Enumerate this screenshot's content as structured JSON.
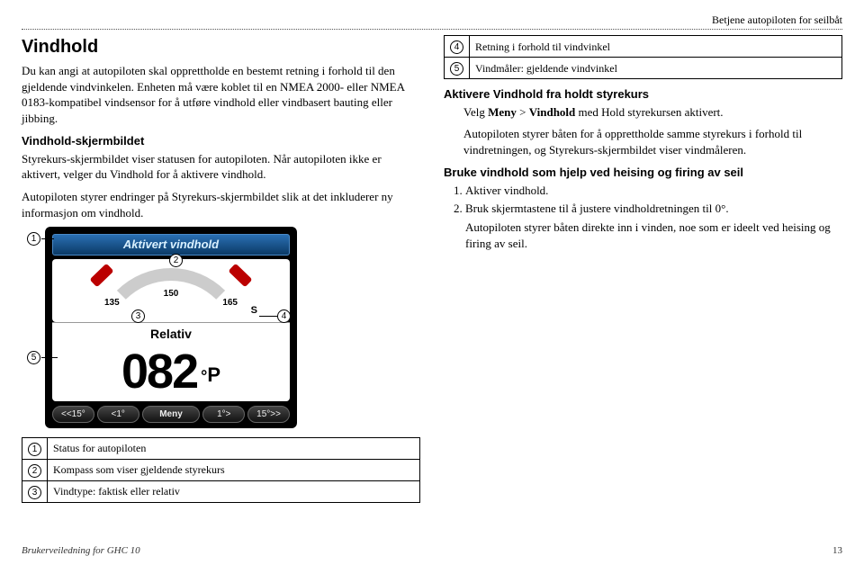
{
  "header_right": "Betjene autopiloten for seilbåt",
  "left": {
    "h1": "Vindhold",
    "p1": "Du kan angi at autopiloten skal opprettholde en bestemt retning i forhold til den gjeldende vindvinkelen. Enheten må være koblet til en NMEA 2000- eller NMEA 0183-kompatibel vindsensor for å utføre vindhold eller vindbasert bauting eller jibbing.",
    "h2a": "Vindhold-skjermbildet",
    "p2": "Styrekurs-skjermbildet viser statusen for autopiloten. Når autopiloten ikke er aktivert, velger du Vindhold for å aktivere vindhold.",
    "p3": "Autopiloten styrer endringer på Styrekurs-skjermbildet slik at det inkluderer ny informasjon om vindhold."
  },
  "right": {
    "row4": "Retning i forhold til vindvinkel",
    "row5": "Vindmåler: gjeldende vindvinkel",
    "h2b": "Aktivere Vindhold fra holdt styrekurs",
    "rb1_pre": "Velg ",
    "rb1_b1": "Meny",
    "rb1_mid": " > ",
    "rb1_b2": "Vindhold",
    "rb1_post": " med Hold styrekursen aktivert.",
    "rb2": "Autopiloten styrer båten for å opprettholde samme styrekurs i forhold til vindretningen, og Styrekurs-skjermbildet viser vindmåleren.",
    "h2c": "Bruke vindhold som hjelp ved heising og firing av seil",
    "step1": "Aktiver vindhold.",
    "step2": "Bruk skjermtastene til å justere vindholdretningen til 0°.",
    "rc": "Autopiloten styrer båten direkte inn i vinden, noe som er ideelt ved heising og firing av seil."
  },
  "device": {
    "title": "Aktivert vindhold",
    "tick_l": "135",
    "tick_c": "150",
    "tick_r": "165",
    "s": "S",
    "relativ": "Relativ",
    "reading": "082",
    "unit_deg": "°",
    "unit_p": "P",
    "btns": [
      "<<15°",
      "<1°",
      "Meny",
      "1°>",
      "15°>>"
    ]
  },
  "lower_rows": {
    "r1": "Status for autopiloten",
    "r2": "Kompass som viser gjeldende styrekurs",
    "r3": "Vindtype: faktisk eller relativ"
  },
  "footer_left": "Brukerveiledning for GHC 10",
  "footer_right": "13"
}
